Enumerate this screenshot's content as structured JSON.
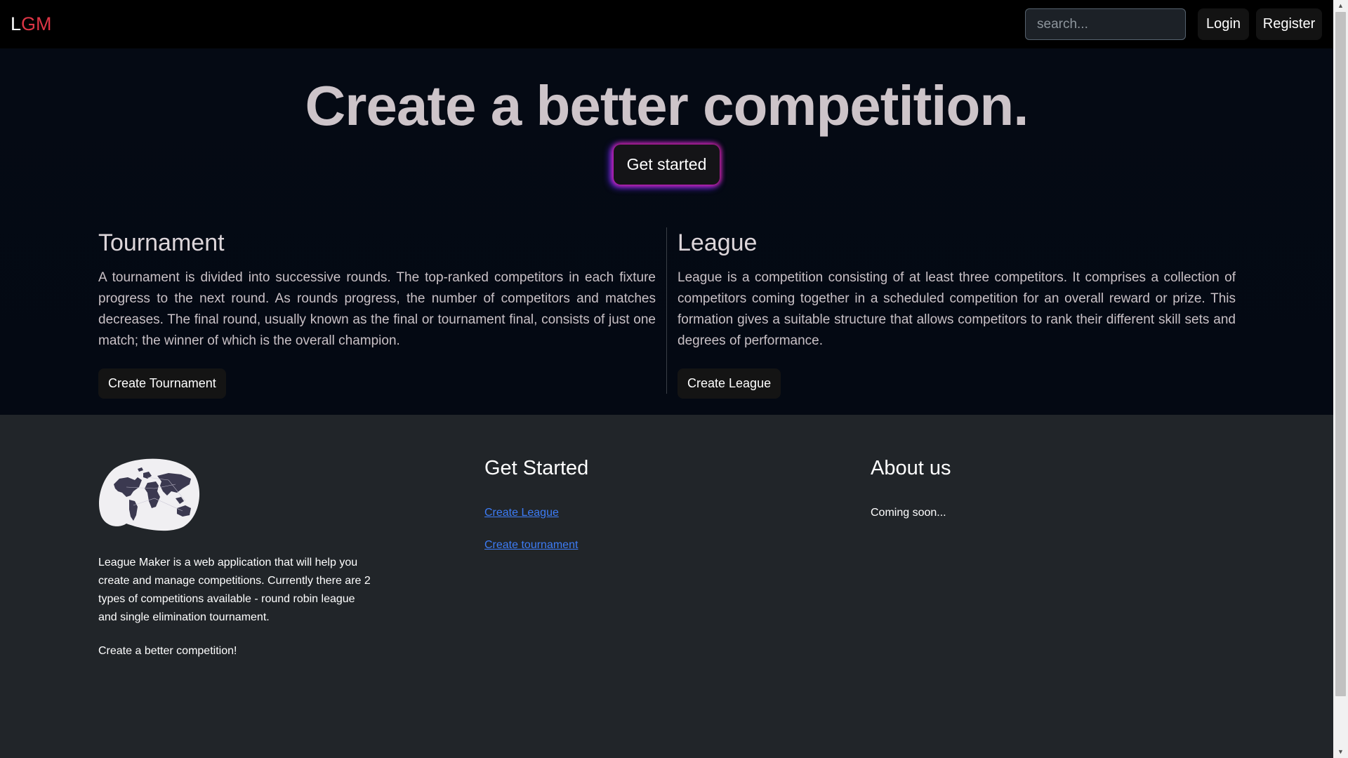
{
  "navbar": {
    "brand_first": "L",
    "brand_rest": "GM",
    "search_placeholder": "search...",
    "login_label": "Login",
    "register_label": "Register"
  },
  "hero": {
    "headline": "Create a better competition.",
    "cta_label": "Get started"
  },
  "tournament": {
    "title": "Tournament",
    "description": "A tournament is divided into successive rounds. The top-ranked competitors in each fixture progress to the next round. As rounds progress, the number of competitors and matches decreases. The final round, usually known as the final or tournament final, consists of just one match; the winner of which is the overall champion.",
    "button_label": "Create Tournament"
  },
  "league": {
    "title": "League",
    "description": "League is a competition consisting of at least three competitors. It comprises a collection of competitors coming together in a scheduled competition for an overall reward or prize. This formation gives a suitable structure that allows competitors to rank their different skill sets and degrees of performance.",
    "button_label": "Create League"
  },
  "footer": {
    "about_text": "League Maker is a web application that will help you create and manage competitions. Currently there are 2 types of competitions available - round robin league and single elimination tournament.",
    "tagline": "Create a better competition!",
    "get_started": {
      "heading": "Get Started",
      "links": [
        "Create League",
        "Create tournament"
      ]
    },
    "about_us": {
      "heading": "About us",
      "text": "Coming soon..."
    }
  },
  "colors": {
    "brand_accent": "#dc3545",
    "link": "#3d7cf5",
    "footer_bg": "#212529",
    "hero_bg": "#050a14"
  },
  "icons": {
    "logo": "world-map-icon"
  }
}
